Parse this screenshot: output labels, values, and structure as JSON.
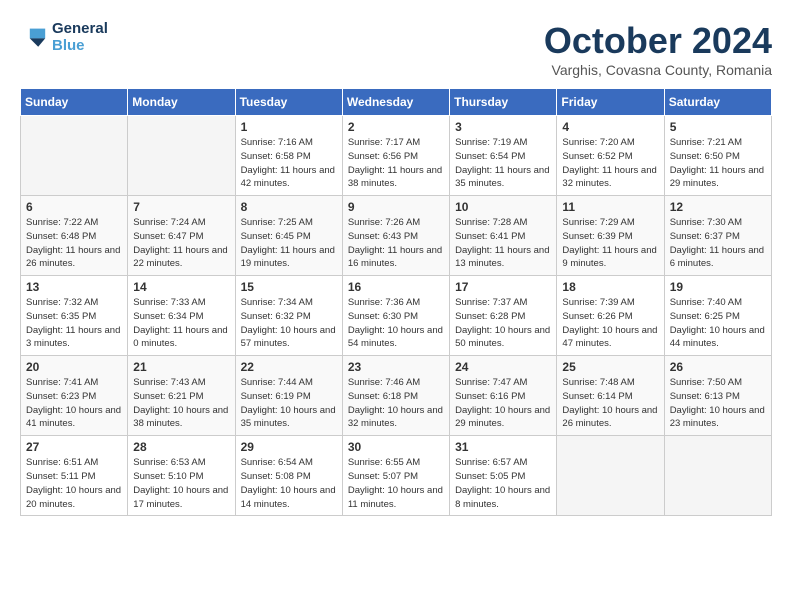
{
  "header": {
    "logo_line1": "General",
    "logo_line2": "Blue",
    "month": "October 2024",
    "location": "Varghis, Covasna County, Romania"
  },
  "days_of_week": [
    "Sunday",
    "Monday",
    "Tuesday",
    "Wednesday",
    "Thursday",
    "Friday",
    "Saturday"
  ],
  "weeks": [
    [
      {
        "day": "",
        "sunrise": "",
        "sunset": "",
        "daylight": ""
      },
      {
        "day": "",
        "sunrise": "",
        "sunset": "",
        "daylight": ""
      },
      {
        "day": "1",
        "sunrise": "Sunrise: 7:16 AM",
        "sunset": "Sunset: 6:58 PM",
        "daylight": "Daylight: 11 hours and 42 minutes."
      },
      {
        "day": "2",
        "sunrise": "Sunrise: 7:17 AM",
        "sunset": "Sunset: 6:56 PM",
        "daylight": "Daylight: 11 hours and 38 minutes."
      },
      {
        "day": "3",
        "sunrise": "Sunrise: 7:19 AM",
        "sunset": "Sunset: 6:54 PM",
        "daylight": "Daylight: 11 hours and 35 minutes."
      },
      {
        "day": "4",
        "sunrise": "Sunrise: 7:20 AM",
        "sunset": "Sunset: 6:52 PM",
        "daylight": "Daylight: 11 hours and 32 minutes."
      },
      {
        "day": "5",
        "sunrise": "Sunrise: 7:21 AM",
        "sunset": "Sunset: 6:50 PM",
        "daylight": "Daylight: 11 hours and 29 minutes."
      }
    ],
    [
      {
        "day": "6",
        "sunrise": "Sunrise: 7:22 AM",
        "sunset": "Sunset: 6:48 PM",
        "daylight": "Daylight: 11 hours and 26 minutes."
      },
      {
        "day": "7",
        "sunrise": "Sunrise: 7:24 AM",
        "sunset": "Sunset: 6:47 PM",
        "daylight": "Daylight: 11 hours and 22 minutes."
      },
      {
        "day": "8",
        "sunrise": "Sunrise: 7:25 AM",
        "sunset": "Sunset: 6:45 PM",
        "daylight": "Daylight: 11 hours and 19 minutes."
      },
      {
        "day": "9",
        "sunrise": "Sunrise: 7:26 AM",
        "sunset": "Sunset: 6:43 PM",
        "daylight": "Daylight: 11 hours and 16 minutes."
      },
      {
        "day": "10",
        "sunrise": "Sunrise: 7:28 AM",
        "sunset": "Sunset: 6:41 PM",
        "daylight": "Daylight: 11 hours and 13 minutes."
      },
      {
        "day": "11",
        "sunrise": "Sunrise: 7:29 AM",
        "sunset": "Sunset: 6:39 PM",
        "daylight": "Daylight: 11 hours and 9 minutes."
      },
      {
        "day": "12",
        "sunrise": "Sunrise: 7:30 AM",
        "sunset": "Sunset: 6:37 PM",
        "daylight": "Daylight: 11 hours and 6 minutes."
      }
    ],
    [
      {
        "day": "13",
        "sunrise": "Sunrise: 7:32 AM",
        "sunset": "Sunset: 6:35 PM",
        "daylight": "Daylight: 11 hours and 3 minutes."
      },
      {
        "day": "14",
        "sunrise": "Sunrise: 7:33 AM",
        "sunset": "Sunset: 6:34 PM",
        "daylight": "Daylight: 11 hours and 0 minutes."
      },
      {
        "day": "15",
        "sunrise": "Sunrise: 7:34 AM",
        "sunset": "Sunset: 6:32 PM",
        "daylight": "Daylight: 10 hours and 57 minutes."
      },
      {
        "day": "16",
        "sunrise": "Sunrise: 7:36 AM",
        "sunset": "Sunset: 6:30 PM",
        "daylight": "Daylight: 10 hours and 54 minutes."
      },
      {
        "day": "17",
        "sunrise": "Sunrise: 7:37 AM",
        "sunset": "Sunset: 6:28 PM",
        "daylight": "Daylight: 10 hours and 50 minutes."
      },
      {
        "day": "18",
        "sunrise": "Sunrise: 7:39 AM",
        "sunset": "Sunset: 6:26 PM",
        "daylight": "Daylight: 10 hours and 47 minutes."
      },
      {
        "day": "19",
        "sunrise": "Sunrise: 7:40 AM",
        "sunset": "Sunset: 6:25 PM",
        "daylight": "Daylight: 10 hours and 44 minutes."
      }
    ],
    [
      {
        "day": "20",
        "sunrise": "Sunrise: 7:41 AM",
        "sunset": "Sunset: 6:23 PM",
        "daylight": "Daylight: 10 hours and 41 minutes."
      },
      {
        "day": "21",
        "sunrise": "Sunrise: 7:43 AM",
        "sunset": "Sunset: 6:21 PM",
        "daylight": "Daylight: 10 hours and 38 minutes."
      },
      {
        "day": "22",
        "sunrise": "Sunrise: 7:44 AM",
        "sunset": "Sunset: 6:19 PM",
        "daylight": "Daylight: 10 hours and 35 minutes."
      },
      {
        "day": "23",
        "sunrise": "Sunrise: 7:46 AM",
        "sunset": "Sunset: 6:18 PM",
        "daylight": "Daylight: 10 hours and 32 minutes."
      },
      {
        "day": "24",
        "sunrise": "Sunrise: 7:47 AM",
        "sunset": "Sunset: 6:16 PM",
        "daylight": "Daylight: 10 hours and 29 minutes."
      },
      {
        "day": "25",
        "sunrise": "Sunrise: 7:48 AM",
        "sunset": "Sunset: 6:14 PM",
        "daylight": "Daylight: 10 hours and 26 minutes."
      },
      {
        "day": "26",
        "sunrise": "Sunrise: 7:50 AM",
        "sunset": "Sunset: 6:13 PM",
        "daylight": "Daylight: 10 hours and 23 minutes."
      }
    ],
    [
      {
        "day": "27",
        "sunrise": "Sunrise: 6:51 AM",
        "sunset": "Sunset: 5:11 PM",
        "daylight": "Daylight: 10 hours and 20 minutes."
      },
      {
        "day": "28",
        "sunrise": "Sunrise: 6:53 AM",
        "sunset": "Sunset: 5:10 PM",
        "daylight": "Daylight: 10 hours and 17 minutes."
      },
      {
        "day": "29",
        "sunrise": "Sunrise: 6:54 AM",
        "sunset": "Sunset: 5:08 PM",
        "daylight": "Daylight: 10 hours and 14 minutes."
      },
      {
        "day": "30",
        "sunrise": "Sunrise: 6:55 AM",
        "sunset": "Sunset: 5:07 PM",
        "daylight": "Daylight: 10 hours and 11 minutes."
      },
      {
        "day": "31",
        "sunrise": "Sunrise: 6:57 AM",
        "sunset": "Sunset: 5:05 PM",
        "daylight": "Daylight: 10 hours and 8 minutes."
      },
      {
        "day": "",
        "sunrise": "",
        "sunset": "",
        "daylight": ""
      },
      {
        "day": "",
        "sunrise": "",
        "sunset": "",
        "daylight": ""
      }
    ]
  ]
}
